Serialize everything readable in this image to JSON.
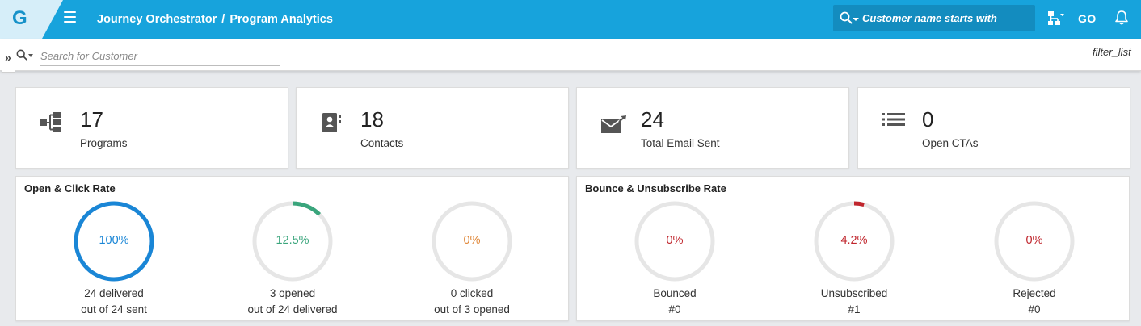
{
  "header": {
    "logo_letter": "G",
    "breadcrumb": [
      "Journey Orchestrator",
      "Program Analytics"
    ],
    "search_placeholder": "Customer name starts with",
    "go_label": "GO",
    "brand_color": "#17a3dc"
  },
  "filterbar": {
    "collapse_label": "»",
    "search_placeholder": "Search for Customer",
    "filter_label": "filter_list"
  },
  "stats": [
    {
      "value": "17",
      "label": "Programs",
      "icon": "program-tree-icon"
    },
    {
      "value": "18",
      "label": "Contacts",
      "icon": "contact-card-icon"
    },
    {
      "value": "24",
      "label": "Total Email Sent",
      "icon": "email-sent-icon"
    },
    {
      "value": "0",
      "label": "Open CTAs",
      "icon": "list-icon"
    }
  ],
  "open_click": {
    "title": "Open & Click Rate",
    "items": [
      {
        "pct": "100%",
        "fraction": 1.0,
        "line1": "24 delivered",
        "line2": "out of 24 sent",
        "color": "#1a86d6"
      },
      {
        "pct": "12.5%",
        "fraction": 0.125,
        "line1": "3 opened",
        "line2": "out of 24 delivered",
        "color": "#3aa57c"
      },
      {
        "pct": "0%",
        "fraction": 0.0,
        "line1": "0 clicked",
        "line2": "out of 3 opened",
        "color": "#e0883a"
      }
    ]
  },
  "bounce_unsub": {
    "title": "Bounce & Unsubscribe Rate",
    "items": [
      {
        "pct": "0%",
        "fraction": 0.0,
        "line1": "Bounced",
        "line2": "#0",
        "color": "#c0262d"
      },
      {
        "pct": "4.2%",
        "fraction": 0.042,
        "line1": "Unsubscribed",
        "line2": "#1",
        "color": "#c0262d"
      },
      {
        "pct": "0%",
        "fraction": 0.0,
        "line1": "Rejected",
        "line2": "#0",
        "color": "#c0262d"
      }
    ]
  }
}
